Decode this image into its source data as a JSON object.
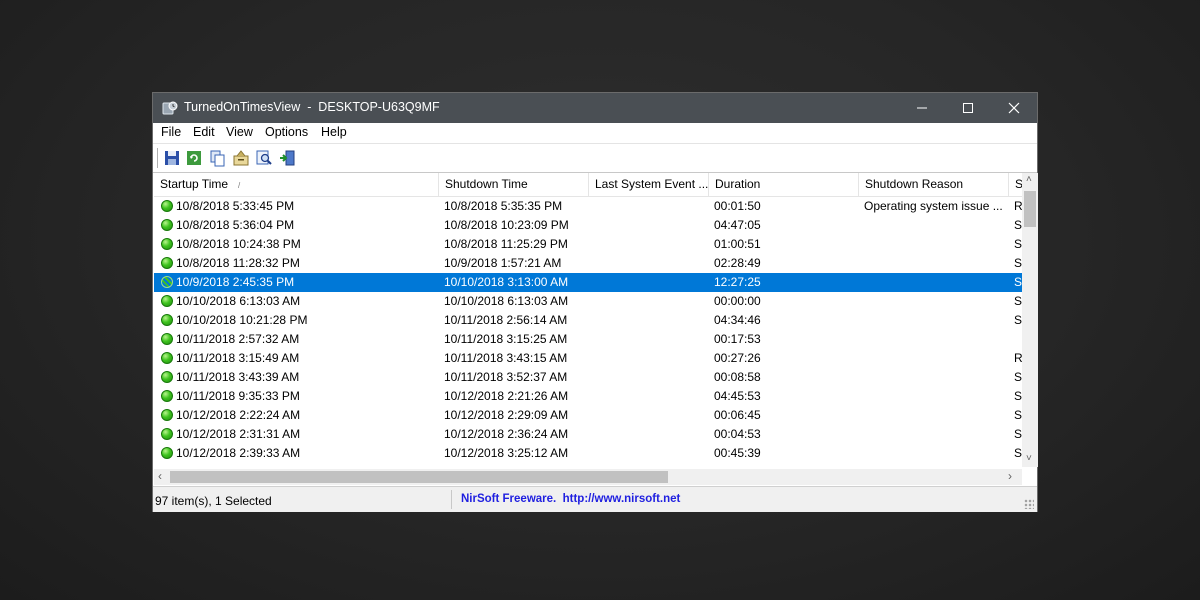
{
  "window": {
    "title": "TurnedOnTimesView  -  DESKTOP-U63Q9MF",
    "icon": "app-icon",
    "controls": [
      "minimize-icon",
      "maximize-icon",
      "close-icon"
    ]
  },
  "menu": [
    "File",
    "Edit",
    "View",
    "Options",
    "Help"
  ],
  "toolbar": {
    "buttons": [
      "save-icon",
      "refresh-icon",
      "copy-icon",
      "properties-icon",
      "find-icon",
      "exit-icon"
    ]
  },
  "columns": [
    "Startup Time",
    "Shutdown Time",
    "Last System Event ...",
    "Duration",
    "Shutdown Reason",
    "S"
  ],
  "sort_indicator": "/",
  "rows": [
    {
      "startup": "10/8/2018 5:33:45 PM",
      "shutdown": "10/8/2018 5:35:35 PM",
      "event": "",
      "duration": "00:01:50",
      "reason": "Operating system issue ...",
      "s": "R"
    },
    {
      "startup": "10/8/2018 5:36:04 PM",
      "shutdown": "10/8/2018 10:23:09 PM",
      "event": "",
      "duration": "04:47:05",
      "reason": "",
      "s": "S"
    },
    {
      "startup": "10/8/2018 10:24:38 PM",
      "shutdown": "10/8/2018 11:25:29 PM",
      "event": "",
      "duration": "01:00:51",
      "reason": "",
      "s": "S"
    },
    {
      "startup": "10/8/2018 11:28:32 PM",
      "shutdown": "10/9/2018 1:57:21 AM",
      "event": "",
      "duration": "02:28:49",
      "reason": "",
      "s": "S"
    },
    {
      "startup": "10/9/2018 2:45:35 PM",
      "shutdown": "10/10/2018 3:13:00 AM",
      "event": "",
      "duration": "12:27:25",
      "reason": "",
      "s": "S"
    },
    {
      "startup": "10/10/2018 6:13:03 AM",
      "shutdown": "10/10/2018 6:13:03 AM",
      "event": "",
      "duration": "00:00:00",
      "reason": "",
      "s": "S"
    },
    {
      "startup": "10/10/2018 10:21:28 PM",
      "shutdown": "10/11/2018 2:56:14 AM",
      "event": "",
      "duration": "04:34:46",
      "reason": "",
      "s": "S"
    },
    {
      "startup": "10/11/2018 2:57:32 AM",
      "shutdown": "10/11/2018 3:15:25 AM",
      "event": "",
      "duration": "00:17:53",
      "reason": "",
      "s": ""
    },
    {
      "startup": "10/11/2018 3:15:49 AM",
      "shutdown": "10/11/2018 3:43:15 AM",
      "event": "",
      "duration": "00:27:26",
      "reason": "",
      "s": "R"
    },
    {
      "startup": "10/11/2018 3:43:39 AM",
      "shutdown": "10/11/2018 3:52:37 AM",
      "event": "",
      "duration": "00:08:58",
      "reason": "",
      "s": "S"
    },
    {
      "startup": "10/11/2018 9:35:33 PM",
      "shutdown": "10/12/2018 2:21:26 AM",
      "event": "",
      "duration": "04:45:53",
      "reason": "",
      "s": "S"
    },
    {
      "startup": "10/12/2018 2:22:24 AM",
      "shutdown": "10/12/2018 2:29:09 AM",
      "event": "",
      "duration": "00:06:45",
      "reason": "",
      "s": "S"
    },
    {
      "startup": "10/12/2018 2:31:31 AM",
      "shutdown": "10/12/2018 2:36:24 AM",
      "event": "",
      "duration": "00:04:53",
      "reason": "",
      "s": "S"
    },
    {
      "startup": "10/12/2018 2:39:33 AM",
      "shutdown": "10/12/2018 3:25:12 AM",
      "event": "",
      "duration": "00:45:39",
      "reason": "",
      "s": "S"
    }
  ],
  "selected_row": 4,
  "status": {
    "count": "97 item(s), 1 Selected",
    "link": "NirSoft Freeware.  http://www.nirsoft.net"
  },
  "colors": {
    "titlebar": "#4a4f54",
    "selection": "#0078d7",
    "link": "#1f1fe0",
    "status_dot": "#3fc41f"
  }
}
